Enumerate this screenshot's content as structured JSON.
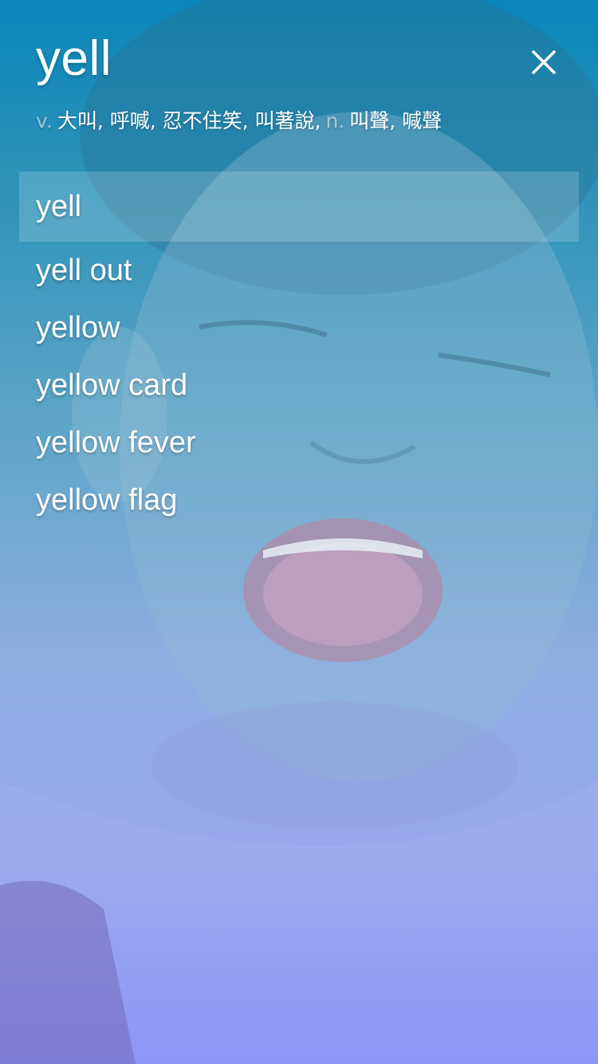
{
  "header": {
    "word": "yell",
    "close_icon": "close-icon"
  },
  "definition": {
    "parts": [
      {
        "pos": "v.",
        "gloss": "大叫, 呼喊, 忍不住笑, 叫著說,"
      },
      {
        "pos": "n.",
        "gloss": "叫聲, 喊聲"
      }
    ]
  },
  "suggestions": [
    {
      "label": "yell",
      "selected": true
    },
    {
      "label": "yell out"
    },
    {
      "label": "yellow"
    },
    {
      "label": "yellow card"
    },
    {
      "label": "yellow fever"
    },
    {
      "label": "yellow flag"
    }
  ],
  "colors": {
    "top": "#0a86bb",
    "bottom": "#7f86f6",
    "selected_row": "rgba(255,255,255,0.17)"
  }
}
